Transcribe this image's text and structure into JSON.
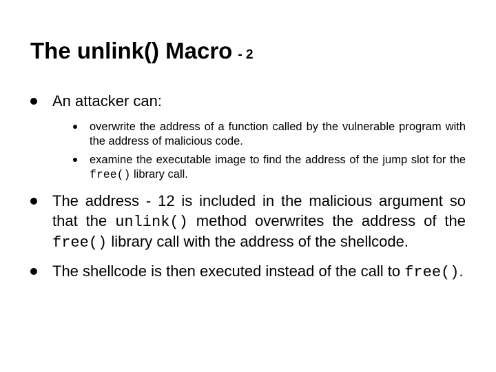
{
  "title": "The unlink() Macro",
  "title_sub": "- 2",
  "l1_items": [
    {
      "text": "An attacker can:",
      "sub": [
        {
          "text": "overwrite the address of a function called by the vulnerable program with the address of malicious code."
        },
        {
          "pre": "examine the executable image to find the address of the jump slot for the ",
          "code": "free()",
          "post": " library call."
        }
      ]
    },
    {
      "segments": [
        {
          "t": "The address - 12 is included in the malicious argument so that the "
        },
        {
          "t": "unlink()",
          "code": true
        },
        {
          "t": " method overwrites the address of the "
        },
        {
          "t": "free()",
          "code": true
        },
        {
          "t": " library call with the address of the shellcode."
        }
      ]
    },
    {
      "segments": [
        {
          "t": "The shellcode is then executed instead of the call to "
        },
        {
          "t": "free()",
          "code": true
        },
        {
          "t": "."
        }
      ]
    }
  ]
}
